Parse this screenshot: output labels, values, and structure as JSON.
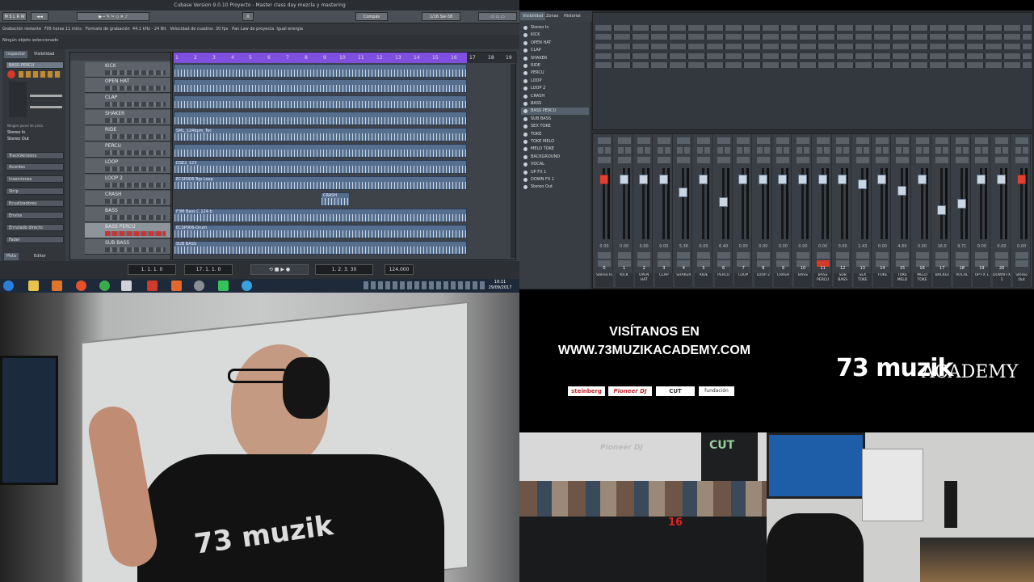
{
  "cubase": {
    "window_title": "Cubase Version 9.0.10 Proyecto - Master class day mezcla y mastering",
    "toolbar": {
      "grid_mode": "Compás",
      "quantize": "1/16 Sw-38"
    },
    "infobar": [
      "Grabación restante",
      "795 horas 11 mins",
      "Formato de grabación",
      "44.1 kHz - 24 Bit",
      "Velocidad de cuadros",
      "30 fps",
      "Pan Law de proyecta",
      "Igual energía"
    ],
    "status": "Ningún objeto seleccionado",
    "inspector": {
      "tabs": [
        "Inspector",
        "Visibilidad"
      ],
      "track": "BASS PERCU",
      "routing_label": "Ningún panel de pista",
      "routing": [
        "Stereo In",
        "Stereo Out"
      ],
      "sections": [
        "TrackVersions",
        "Acordes",
        "Inserciones",
        "Strip",
        "Ecualizadores",
        "Envíos",
        "Enrutado directo",
        "Fader"
      ],
      "bottom_tabs": [
        "Pista",
        "Editor"
      ]
    },
    "tracks": [
      "KICK",
      "OPEN HAT",
      "CLAP",
      "SHAKER",
      "RIDE",
      "PERCU",
      "LOOP",
      "LOOP 2",
      "CRASH",
      "BASS",
      "BASS PERCU",
      "SUB BASS"
    ],
    "ruler": [
      "1",
      "2",
      "3",
      "4",
      "5",
      "6",
      "7",
      "8",
      "9",
      "10",
      "11",
      "12",
      "13",
      "14",
      "15",
      "16",
      "17",
      "18",
      "19"
    ],
    "part_labels": {
      "ride": "SML_124bpm_Tec",
      "loop": "DSE2_123_",
      "loop2": "ECSP006-Top Loop",
      "crash": "CRASH",
      "bass": "F3M Bass C 124 b",
      "bass_percu": "ECSP006-Drum",
      "sub_bass": "SUB BASS"
    },
    "transport": {
      "left_locator": "1. 1. 1. 0",
      "right_locator": "17. 1. 1. 0",
      "position": "1. 2. 3. 30",
      "tempo": "124.000"
    }
  },
  "taskbar": {
    "time": "10:11",
    "date": "29/09/2017",
    "icons": [
      "windows-start",
      "file-explorer",
      "media-player",
      "firefox",
      "chrome",
      "cubase",
      "app-red",
      "app-orange",
      "app-gray",
      "app-green",
      "app-blue"
    ]
  },
  "mixer": {
    "tabs": [
      "Visibilidad",
      "Zonas",
      "Historial"
    ],
    "visibility": [
      "Stereo In",
      "KICK",
      "OPEN HAT",
      "CLAP",
      "SHAKER",
      "RIDE",
      "PERCU",
      "LOOP",
      "LOOP 2",
      "CRASH",
      "BASS",
      "BASS PERCU",
      "SUB BASS",
      "SEX TOKE",
      "TOKE",
      "TOKE MELO",
      "MELO TOKE",
      "BACKGROUND",
      "VOCAL",
      "UP FX 1",
      "DOWN FX 1",
      "Stereo Out"
    ],
    "channels": [
      {
        "num": "0",
        "name": "Stereo In",
        "val": "0.00"
      },
      {
        "num": "1",
        "name": "KICK",
        "val": "0.00"
      },
      {
        "num": "2",
        "name": "OPEN HAT",
        "val": "0.00"
      },
      {
        "num": "3",
        "name": "CLAP",
        "val": "0.00"
      },
      {
        "num": "4",
        "name": "SHAKER",
        "val": "5.36"
      },
      {
        "num": "5",
        "name": "RIDE",
        "val": "0.00"
      },
      {
        "num": "6",
        "name": "PERCU",
        "val": "6.40"
      },
      {
        "num": "7",
        "name": "LOOP",
        "val": "0.00"
      },
      {
        "num": "8",
        "name": "LOOP 2",
        "val": "0.00"
      },
      {
        "num": "9",
        "name": "CRASH",
        "val": "0.00"
      },
      {
        "num": "10",
        "name": "BASS",
        "val": "0.00"
      },
      {
        "num": "11",
        "name": "BASS PERCU",
        "val": "0.00"
      },
      {
        "num": "12",
        "name": "SUB BASS",
        "val": "0.00"
      },
      {
        "num": "13",
        "name": "SEX TOKE",
        "val": "1.43"
      },
      {
        "num": "14",
        "name": "TOKE",
        "val": "0.00"
      },
      {
        "num": "15",
        "name": "TOKE MELO",
        "val": "4.60"
      },
      {
        "num": "16",
        "name": "MELO TOKE",
        "val": "0.00"
      },
      {
        "num": "17",
        "name": "BACKGI",
        "val": "16.0"
      },
      {
        "num": "18",
        "name": "VOCAL",
        "val": "9.71"
      },
      {
        "num": "19",
        "name": "UP FX 1",
        "val": "0.00"
      },
      {
        "num": "20",
        "name": "DOWN FX 1",
        "val": "0.00"
      },
      {
        "num": "",
        "name": "Stereo Out",
        "val": "0.00"
      }
    ]
  },
  "promo": {
    "line1": "VISÍTANOS EN",
    "line2": "WWW.73MUZIKACADEMY.COM",
    "sponsors": [
      "steinberg",
      "Pioneer DJ",
      "CUT",
      "fundación"
    ],
    "logo_main": "73 muzik",
    "logo_sub": "ACADEMY"
  },
  "scenes": {
    "class_banner": "Pioneer DJ",
    "class_sign": "CUT",
    "shirt_logo": "73 muzik"
  },
  "colors": {
    "loop_region": "#7f4fe0",
    "part_blue": "#566f8f",
    "cubase_bg": "#3a3f45"
  }
}
